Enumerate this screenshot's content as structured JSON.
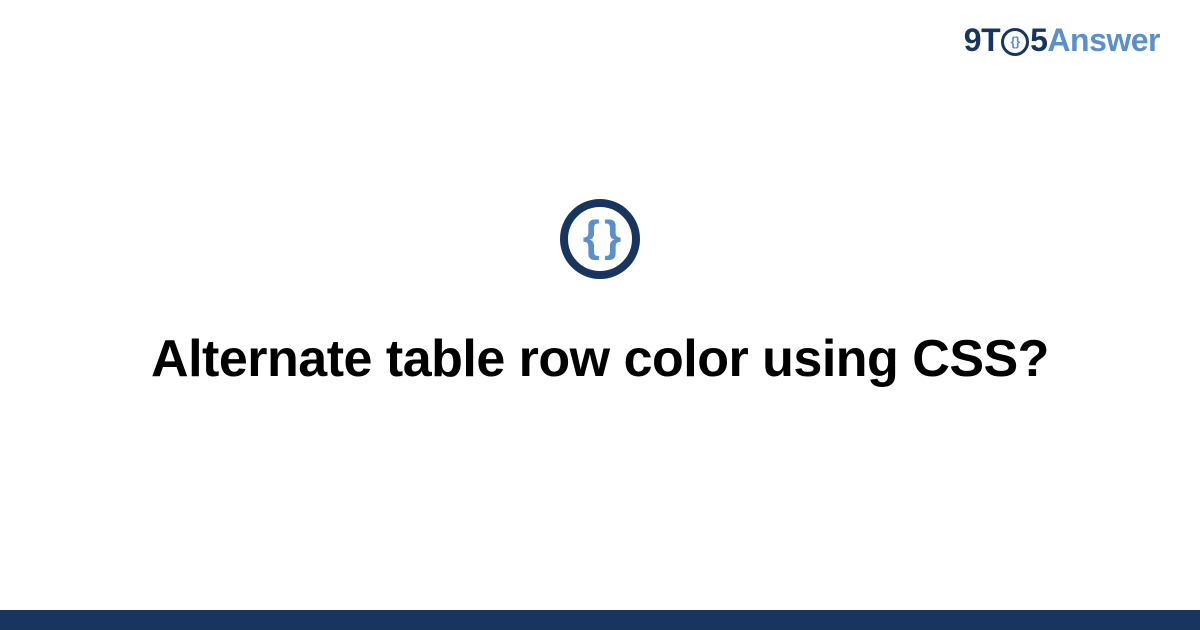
{
  "brand": {
    "prefix": "9T",
    "circle_inner": "{}",
    "mid": "5",
    "suffix": "Answer"
  },
  "icon": {
    "glyph": "{ }"
  },
  "title": "Alternate table row color using CSS?",
  "colors": {
    "dark": "#17355f",
    "accent": "#5a8fc9"
  }
}
